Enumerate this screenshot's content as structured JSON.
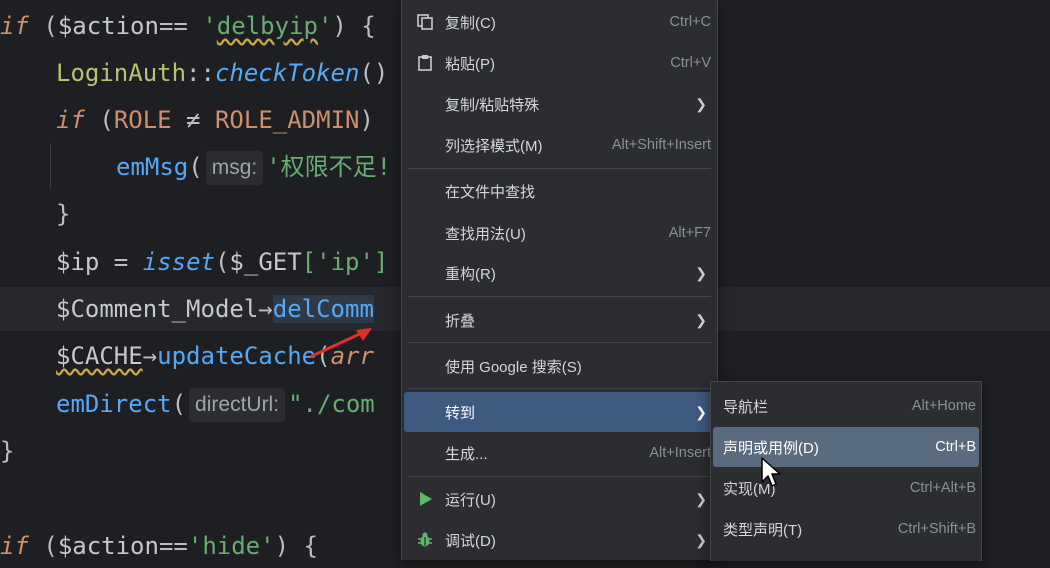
{
  "editor": {
    "lines": [
      {
        "parts": [
          "if",
          " (",
          "$action",
          "== ",
          "'delbyip'",
          ") {"
        ]
      },
      {
        "parts": [
          "LoginAuth",
          "::",
          "checkToken",
          "()"
        ]
      },
      {
        "parts": [
          "if",
          " (",
          "ROLE",
          " ≠ ",
          "ROLE_ADMIN",
          ")"
        ]
      },
      {
        "parts": [
          "emMsg",
          "(",
          "msg:",
          "'权限不足!"
        ]
      },
      {
        "parts": [
          "}"
        ]
      },
      {
        "parts": [
          "$ip",
          " = ",
          "isset",
          "(",
          "$_GET",
          "['ip']"
        ]
      },
      {
        "parts": [
          "$Comment_Model",
          "→",
          "delComm"
        ]
      },
      {
        "parts": [
          "$CACHE",
          "→",
          "updateCache",
          "(",
          "arr"
        ]
      },
      {
        "parts": [
          "emDirect",
          "(",
          "directUrl:",
          "\"./com"
        ]
      },
      {
        "parts": [
          "}"
        ]
      },
      {
        "parts": [
          ""
        ]
      },
      {
        "parts": [
          "if",
          " (",
          "$action",
          "==",
          "'hide'",
          ") {"
        ]
      }
    ]
  },
  "context_menu": {
    "items": [
      {
        "icon": "copy-icon",
        "label": "复制(C)",
        "shortcut": "Ctrl+C"
      },
      {
        "icon": "paste-icon",
        "label": "粘贴(P)",
        "shortcut": "Ctrl+V"
      },
      {
        "label": "复制/粘贴特殊",
        "submenu": true
      },
      {
        "label": "列选择模式(M)",
        "shortcut": "Alt+Shift+Insert"
      },
      {
        "label": "在文件中查找"
      },
      {
        "label": "查找用法(U)",
        "shortcut": "Alt+F7"
      },
      {
        "label": "重构(R)",
        "submenu": true
      },
      {
        "label": "折叠",
        "submenu": true
      },
      {
        "label": "使用 Google 搜索(S)"
      },
      {
        "label": "转到",
        "submenu": true,
        "highlighted": true
      },
      {
        "label": "生成...",
        "shortcut": "Alt+Insert"
      },
      {
        "icon": "run-icon",
        "label": "运行(U)",
        "submenu": true
      },
      {
        "icon": "debug-icon",
        "label": "调试(D)",
        "submenu": true
      }
    ]
  },
  "goto_submenu": {
    "items": [
      {
        "label": "导航栏",
        "shortcut": "Alt+Home"
      },
      {
        "label": "声明或用例(D)",
        "shortcut": "Ctrl+B",
        "highlighted": true
      },
      {
        "label": "实现(M)",
        "shortcut": "Ctrl+Alt+B"
      },
      {
        "label": "类型声明(T)",
        "shortcut": "Ctrl+Shift+B"
      }
    ]
  },
  "colors": {
    "editor_bg": "#1e1f22",
    "menu_bg": "#2b2d30",
    "highlight": "#3d5a80",
    "sub_highlight": "#5a6b7f",
    "annotation_arrow": "#e0302a"
  }
}
